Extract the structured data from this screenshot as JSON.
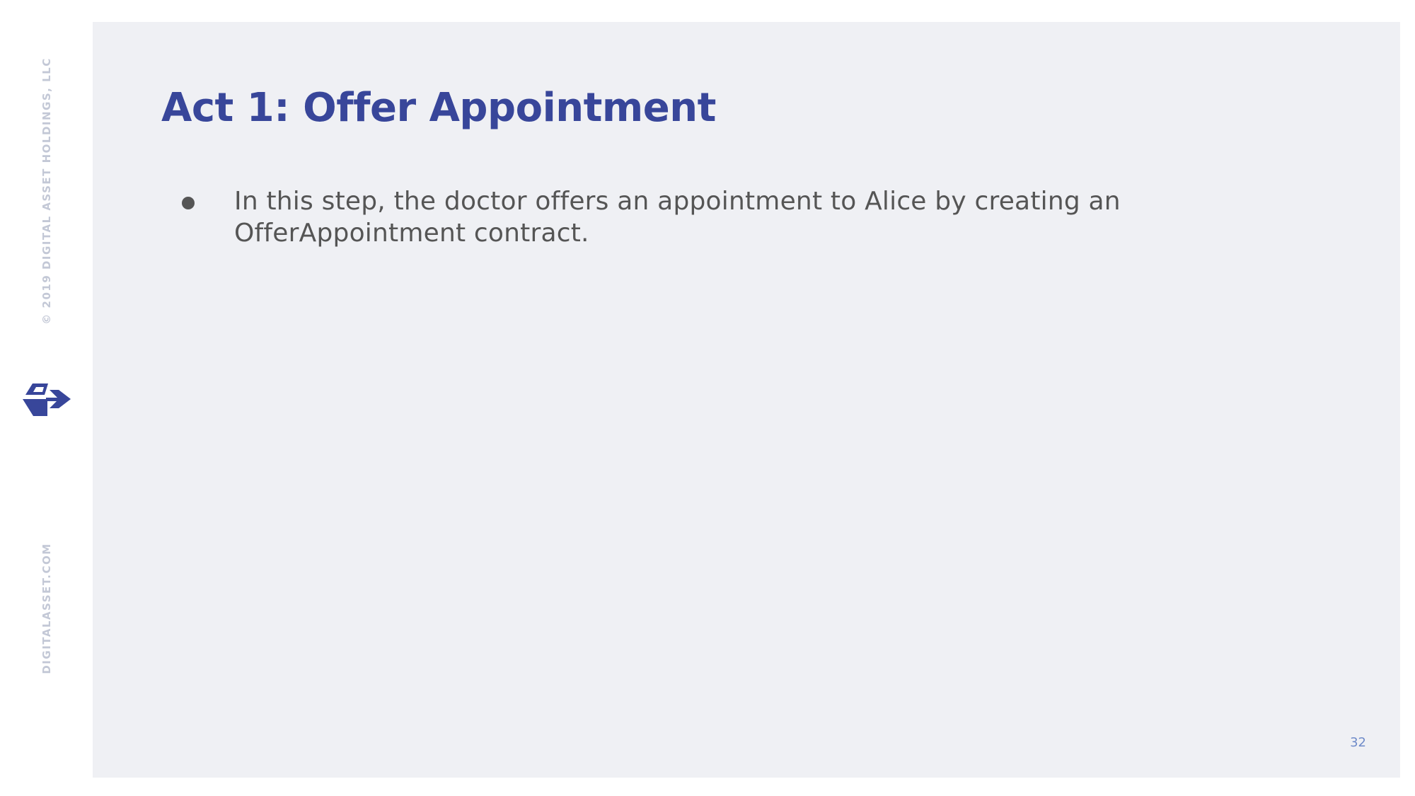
{
  "sidebar": {
    "copyright": "© 2019 DIGITAL ASSET HOLDINGS, LLC",
    "website": "DIGITALASSET.COM",
    "logo_icon": "digital-asset-logo"
  },
  "slide": {
    "title": "Act 1: Offer Appointment",
    "bullets": [
      "In this step, the doctor offers an appointment to Alice by creating an OfferAppointment contract."
    ],
    "page_number": "32"
  },
  "colors": {
    "title": "#38469a",
    "body_text": "#555555",
    "background": "#eff0f4",
    "sidebar_text": "#c3c8d6",
    "page_number": "#6f8bc9"
  }
}
